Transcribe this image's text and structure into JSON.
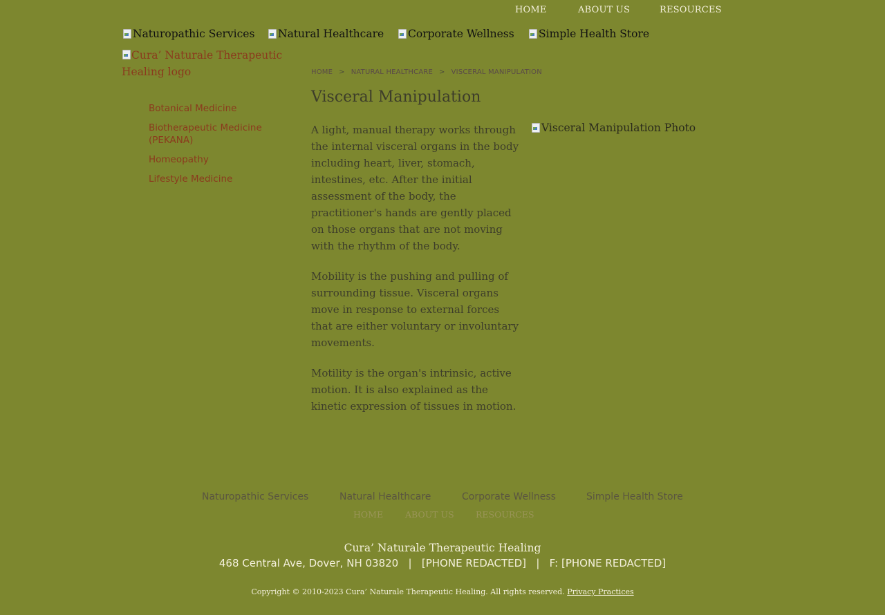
{
  "top_nav": {
    "home": "HOME",
    "about": "ABOUT US",
    "resources": "RESOURCES"
  },
  "main_nav": {
    "naturopathic": "Naturopathic Services",
    "natural_healthcare": "Natural Healthcare",
    "corporate": "Corporate Wellness",
    "store": "Simple Health Store"
  },
  "logo_alt": "Cura’ Naturale Therapeutic Healing logo",
  "side_nav": {
    "items": [
      {
        "label": "Botanical Medicine"
      },
      {
        "label": "Biotherapeutic Medicine (PEKANA)"
      },
      {
        "label": "Homeopathy"
      },
      {
        "label": "Lifestyle Medicine"
      }
    ]
  },
  "breadcrumb": {
    "home": "HOME",
    "sep": ">",
    "section": "NATURAL HEALTHCARE",
    "current": "VISCERAL MANIPULATION"
  },
  "page": {
    "title": "Visceral Manipulation",
    "paragraphs": [
      "A light, manual therapy works through the internal visceral organs in the body including heart, liver, stomach, intestines, etc. After the initial assessment of the body, the practitioner's hands are gently placed on those organs that are not moving with the rhythm of the body.",
      "Mobility is the pushing and pulling of surrounding tissue. Visceral organs move in response to external forces that are either voluntary or involuntary movements.",
      "Motility is the organ's intrinsic, active motion. It is also explained as the kinetic expression of tissues in motion."
    ],
    "photo_alt": "Visceral Manipulation Photo"
  },
  "footer": {
    "nav": {
      "naturopathic": "Naturopathic Services",
      "natural_healthcare": "Natural Healthcare",
      "corporate": "Corporate Wellness",
      "store": "Simple Health Store"
    },
    "util": {
      "home": "HOME",
      "about": "ABOUT US",
      "resources": "RESOURCES"
    },
    "business_name": "Cura’ Naturale Therapeutic Healing",
    "contact_line": "468 Central Ave, Dover, NH 03820   |   [PHONE REDACTED]   |   F: [PHONE REDACTED]",
    "copyright": "Copyright © 2010-2023 Cura’ Naturale Therapeutic Healing. All rights reserved.",
    "privacy": "Privacy Practices"
  },
  "colors": {
    "background": "#7d872f",
    "link": "#8b3a1d",
    "text": "#3d3d2a",
    "light_text": "#f4f0dc"
  },
  "icons": {
    "broken_image": "broken-image-icon"
  }
}
